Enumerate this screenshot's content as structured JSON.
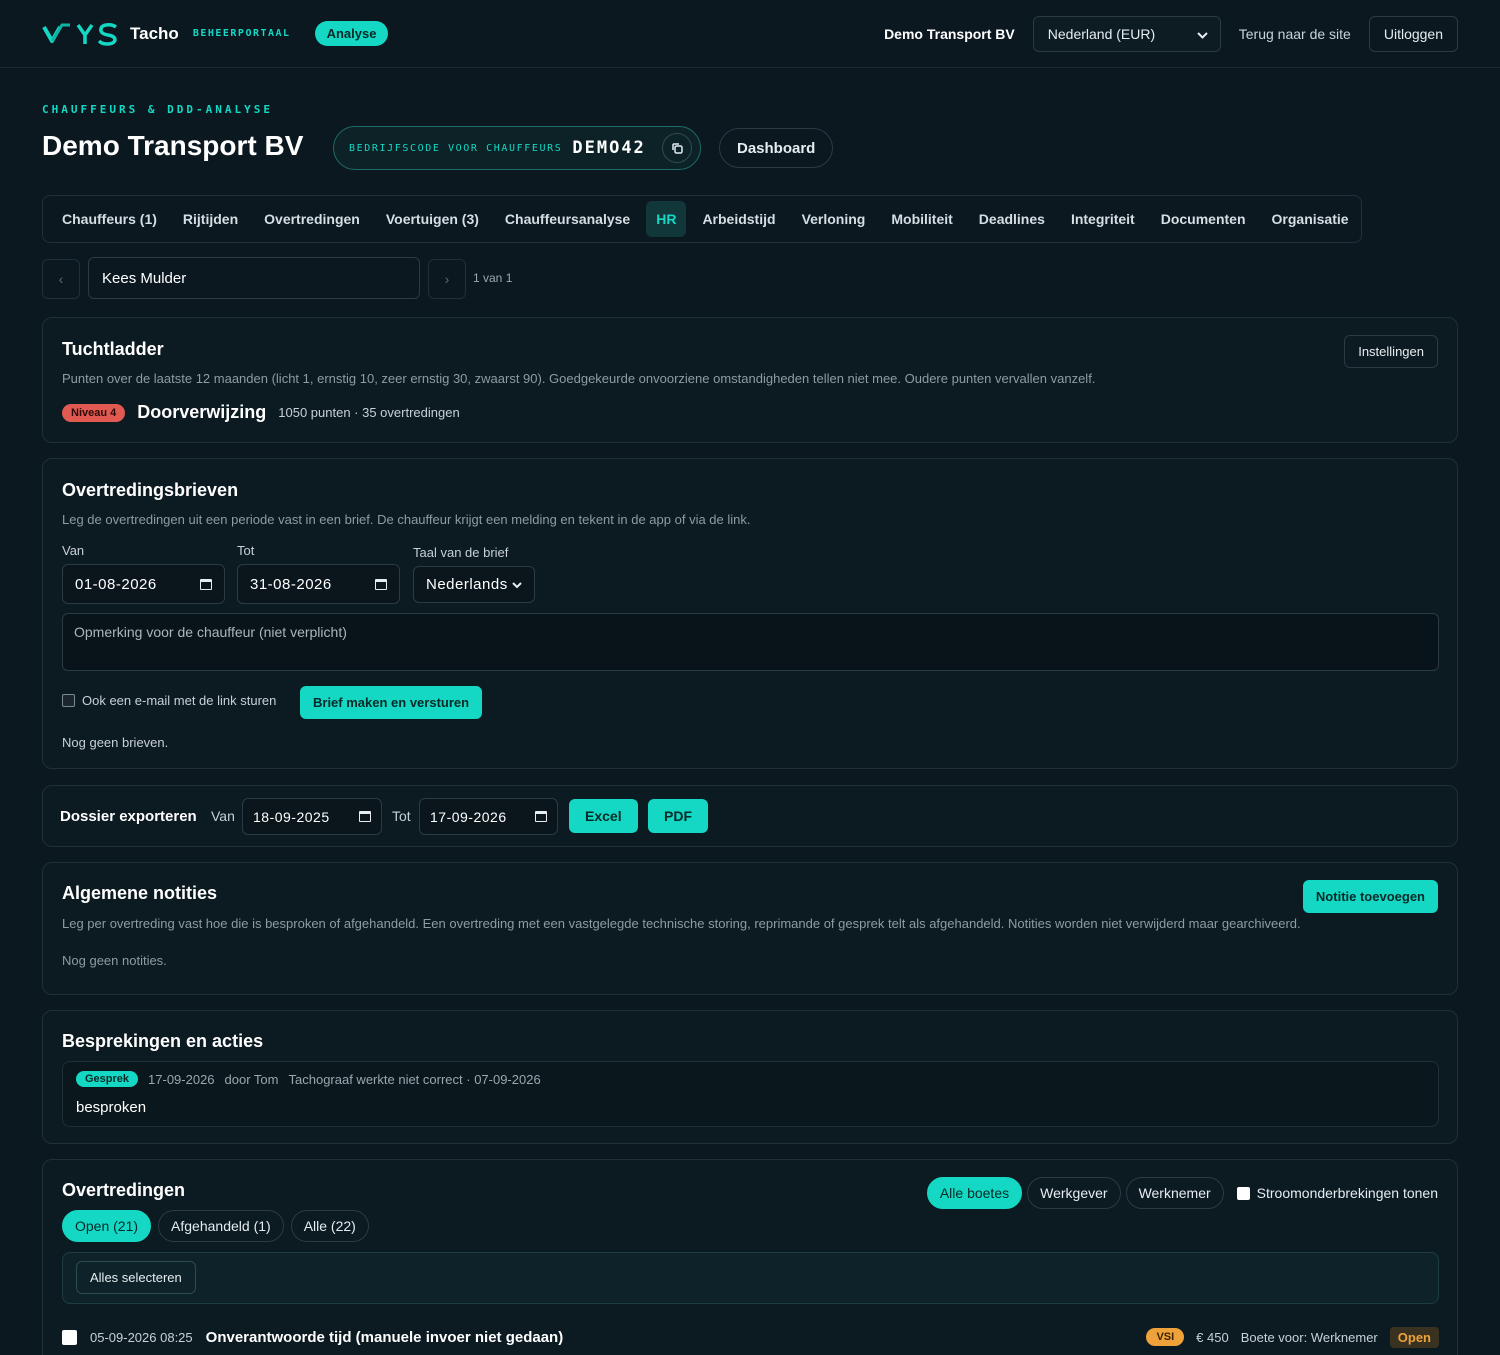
{
  "topbar": {
    "logo_text": "Tacho",
    "logo_sub": "BEHEERPORTAAL",
    "analyse_badge": "Analyse",
    "company": "Demo Transport BV",
    "region": "Nederland (EUR)",
    "back_link": "Terug naar de site",
    "logout": "Uitloggen"
  },
  "header": {
    "eyebrow": "CHAUFFEURS & DDD-ANALYSE",
    "title": "Demo Transport BV",
    "code_label": "BEDRIJFSCODE VOOR CHAUFFEURS",
    "code_value": "DEMO42",
    "dashboard_button": "Dashboard"
  },
  "tabs": [
    "Chauffeurs (1)",
    "Rijtijden",
    "Overtredingen",
    "Voertuigen (3)",
    "Chauffeursanalyse",
    "HR",
    "Arbeidstijd",
    "Verloning",
    "Mobiliteit",
    "Deadlines",
    "Integriteit",
    "Documenten",
    "Organisatie"
  ],
  "active_tab": "HR",
  "driver_nav": {
    "prev": "‹",
    "next": "›",
    "driver": "Kees Mulder",
    "pager": "1 van 1"
  },
  "tuchtladder": {
    "title": "Tuchtladder",
    "settings": "Instellingen",
    "description": "Punten over de laatste 12 maanden (licht 1, ernstig 10, zeer ernstig 30, zwaarst 90). Goedgekeurde onvoorziene omstandigheden tellen niet mee. Oudere punten vervallen vanzelf.",
    "level_badge": "Niveau 4",
    "level_name": "Doorverwijzing",
    "level_detail": "1050 punten · 35 overtredingen"
  },
  "brieven": {
    "title": "Overtredingsbrieven",
    "description": "Leg de overtredingen uit een periode vast in een brief. De chauffeur krijgt een melding en tekent in de app of via de link.",
    "from_label": "Van",
    "from_value": "01-08-2026",
    "to_label": "Tot",
    "to_value": "31-08-2026",
    "lang_label": "Taal van de brief",
    "lang_value": "Nederlands",
    "remark_placeholder": "Opmerking voor de chauffeur (niet verplicht)",
    "email_checkbox": "Ook een e-mail met de link sturen",
    "submit": "Brief maken en versturen",
    "empty": "Nog geen brieven."
  },
  "export": {
    "title": "Dossier exporteren",
    "from_label": "Van",
    "from_value": "18-09-2025",
    "to_label": "Tot",
    "to_value": "17-09-2026",
    "excel": "Excel",
    "pdf": "PDF"
  },
  "notities": {
    "title": "Algemene notities",
    "add": "Notitie toevoegen",
    "description": "Leg per overtreding vast hoe die is besproken of afgehandeld. Een overtreding met een vastgelegde technische storing, reprimande of gesprek telt als afgehandeld. Notities worden niet verwijderd maar gearchiveerd.",
    "empty": "Nog geen notities."
  },
  "besprekingen": {
    "title": "Besprekingen en acties",
    "item": {
      "tag": "Gesprek",
      "date": "17-09-2026",
      "by": "door Tom",
      "subject": "Tachograaf werkte niet correct · 07-09-2026",
      "text": "besproken"
    }
  },
  "overtredingen": {
    "title": "Overtredingen",
    "filters": [
      "Alle boetes",
      "Werkgever",
      "Werknemer"
    ],
    "active_filter": "Alle boetes",
    "interruptions_label": "Stroomonderbrekingen tonen",
    "status_tabs": [
      "Open (21)",
      "Afgehandeld (1)",
      "Alle (22)"
    ],
    "active_status": "Open (21)",
    "select_all": "Alles selecteren",
    "row": {
      "datetime": "05-09-2026 08:25",
      "title": "Onverantwoorde tijd (manuele invoer niet gedaan)",
      "tag": "VSI",
      "amount": "€ 450",
      "fine_for": "Boete voor: Werknemer",
      "status": "Open"
    }
  },
  "colors": {
    "accent": "#14d8c4",
    "background": "#0b1820",
    "danger": "#e05a52",
    "warning": "#f0a23a"
  }
}
